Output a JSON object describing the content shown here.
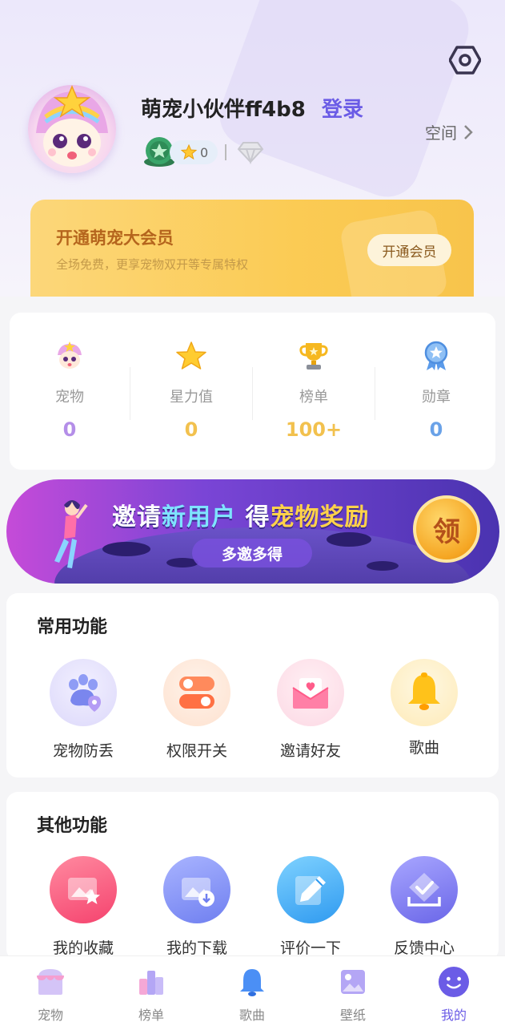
{
  "profile": {
    "username": "萌宠小伙伴ff4b8",
    "login_label": "登录",
    "star_count": "0",
    "space_label": "空间"
  },
  "vip": {
    "title": "开通萌宠大会员",
    "subtitle": "全场免费，更享宠物双开等专属特权",
    "button_label": "开通会员"
  },
  "stats": [
    {
      "label": "宠物",
      "value": "0",
      "color": "#b48ee8"
    },
    {
      "label": "星力值",
      "value": "0",
      "color": "#f2c14e"
    },
    {
      "label": "榜单",
      "value": "100+",
      "color": "#f2c14e"
    },
    {
      "label": "勋章",
      "value": "0",
      "color": "#6aa2e8"
    }
  ],
  "banner": {
    "title_part1": "邀请",
    "title_part2": "新用户",
    "title_part3": " 得",
    "title_part4": "宠物奖励",
    "pill_label": "多邀多得",
    "coin_label": "领"
  },
  "common_functions": {
    "title": "常用功能",
    "items": [
      {
        "label": "宠物防丢",
        "icon": "paw-location-icon"
      },
      {
        "label": "权限开关",
        "icon": "toggle-icon"
      },
      {
        "label": "邀请好友",
        "icon": "envelope-heart-icon"
      },
      {
        "label": "歌曲",
        "icon": "bell-icon"
      }
    ]
  },
  "other_functions": {
    "title": "其他功能",
    "items": [
      {
        "label": "我的收藏",
        "icon": "favorite-image-icon"
      },
      {
        "label": "我的下载",
        "icon": "download-image-icon"
      },
      {
        "label": "评价一下",
        "icon": "pencil-icon"
      },
      {
        "label": "反馈中心",
        "icon": "feedback-check-icon"
      }
    ]
  },
  "tabbar": {
    "tabs": [
      {
        "label": "宠物",
        "icon": "house-icon"
      },
      {
        "label": "榜单",
        "icon": "bars-icon"
      },
      {
        "label": "歌曲",
        "icon": "bell-icon"
      },
      {
        "label": "壁纸",
        "icon": "picture-icon"
      },
      {
        "label": "我的",
        "icon": "smile-icon"
      }
    ],
    "active_tab": "我的"
  },
  "colors": {
    "accent": "#6b5ce6",
    "vip_gold": "#fbcb54"
  }
}
